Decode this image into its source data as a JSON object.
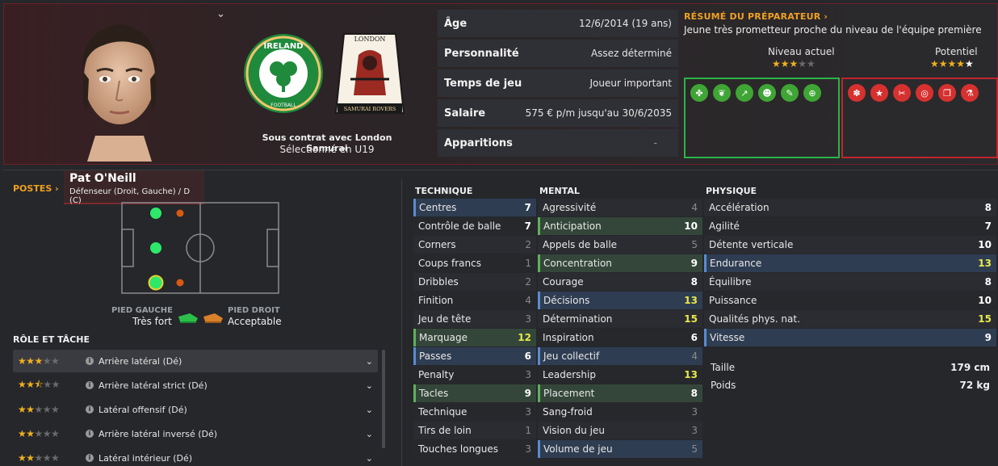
{
  "player": {
    "name": "Pat O'Neill",
    "positions_text": "Défenseur (Droit, Gauche) / D (C)",
    "contract": "Sous contrat avec London Samurai",
    "selection": "Sélectionné en U19"
  },
  "info": [
    {
      "label": "Âge",
      "value": "12/6/2014 (19 ans)"
    },
    {
      "label": "Personnalité",
      "value": "Assez déterminé"
    },
    {
      "label": "Temps de jeu",
      "value": "Joueur important"
    },
    {
      "label": "Salaire",
      "value": "575 € p/m jusqu'au 30/6/2035"
    },
    {
      "label": "Apparitions",
      "value": "-"
    }
  ],
  "coach": {
    "title": "RÉSUMÉ DU PRÉPARATEUR ›",
    "text": "Jeune très prometteur proche du niveau de l'équipe première",
    "current_label": "Niveau actuel",
    "current_stars": 3,
    "potential_label": "Potentiel",
    "potential_stars": 4.5
  },
  "positions_label": "POSTES ›",
  "feet": {
    "left_label": "PIED GAUCHE",
    "left_value": "Très fort",
    "right_label": "PIED DROIT",
    "right_value": "Acceptable"
  },
  "roles": {
    "title": "RÔLE ET TÂCHE",
    "items": [
      {
        "name": "Arrière latéral (Dé)",
        "stars": 3
      },
      {
        "name": "Arrière latéral strict (Dé)",
        "stars": 2.5
      },
      {
        "name": "Latéral offensif (Dé)",
        "stars": 2
      },
      {
        "name": "Arrière latéral inversé (Dé)",
        "stars": 2
      },
      {
        "name": "Latéral intérieur (Dé)",
        "stars": 2
      }
    ]
  },
  "technique": {
    "title": "TECHNIQUE",
    "rows": [
      {
        "name": "Centres",
        "value": "7",
        "style": "bl"
      },
      {
        "name": "Contrôle de balle",
        "value": "7",
        "style": ""
      },
      {
        "name": "Corners",
        "value": "2",
        "style": ""
      },
      {
        "name": "Coups francs",
        "value": "1",
        "style": ""
      },
      {
        "name": "Dribbles",
        "value": "2",
        "style": ""
      },
      {
        "name": "Finition",
        "value": "4",
        "style": ""
      },
      {
        "name": "Jeu de tête",
        "value": "3",
        "style": ""
      },
      {
        "name": "Marquage",
        "value": "12",
        "style": "gr"
      },
      {
        "name": "Passes",
        "value": "6",
        "style": "bl"
      },
      {
        "name": "Penalty",
        "value": "3",
        "style": ""
      },
      {
        "name": "Tacles",
        "value": "9",
        "style": "gr"
      },
      {
        "name": "Technique",
        "value": "3",
        "style": ""
      },
      {
        "name": "Tirs de loin",
        "value": "1",
        "style": ""
      },
      {
        "name": "Touches longues",
        "value": "3",
        "style": ""
      }
    ]
  },
  "mental": {
    "title": "MENTAL",
    "rows": [
      {
        "name": "Agressivité",
        "value": "4",
        "style": ""
      },
      {
        "name": "Anticipation",
        "value": "10",
        "style": "gr"
      },
      {
        "name": "Appels de balle",
        "value": "5",
        "style": ""
      },
      {
        "name": "Concentration",
        "value": "9",
        "style": "gr"
      },
      {
        "name": "Courage",
        "value": "8",
        "style": ""
      },
      {
        "name": "Décisions",
        "value": "13",
        "style": "bl"
      },
      {
        "name": "Détermination",
        "value": "15",
        "style": ""
      },
      {
        "name": "Inspiration",
        "value": "6",
        "style": ""
      },
      {
        "name": "Jeu collectif",
        "value": "4",
        "style": "bl"
      },
      {
        "name": "Leadership",
        "value": "13",
        "style": ""
      },
      {
        "name": "Placement",
        "value": "8",
        "style": "gr"
      },
      {
        "name": "Sang-froid",
        "value": "3",
        "style": ""
      },
      {
        "name": "Vision du jeu",
        "value": "3",
        "style": ""
      },
      {
        "name": "Volume de jeu",
        "value": "5",
        "style": "bl"
      }
    ]
  },
  "physique": {
    "title": "PHYSIQUE",
    "rows": [
      {
        "name": "Accélération",
        "value": "8",
        "style": ""
      },
      {
        "name": "Agilité",
        "value": "7",
        "style": ""
      },
      {
        "name": "Détente verticale",
        "value": "10",
        "style": ""
      },
      {
        "name": "Endurance",
        "value": "13",
        "style": "bl"
      },
      {
        "name": "Équilibre",
        "value": "8",
        "style": ""
      },
      {
        "name": "Puissance",
        "value": "10",
        "style": ""
      },
      {
        "name": "Qualités phys. nat.",
        "value": "15",
        "style": ""
      },
      {
        "name": "Vitesse",
        "value": "9",
        "style": "bl"
      }
    ],
    "height_label": "Taille",
    "height_value": "179 cm",
    "weight_label": "Poids",
    "weight_value": "72 kg"
  },
  "logos": {
    "ireland_text": "IRELAND",
    "ireland_sub": "FOOTBALL",
    "london_top": "LONDON",
    "london_bottom": "SAMURAI ROVERS"
  },
  "colors": {
    "accent": "#f0a020",
    "green_box": "#2bb34a",
    "red_box": "#c0252d",
    "highlight_value": "#e8e84a"
  }
}
